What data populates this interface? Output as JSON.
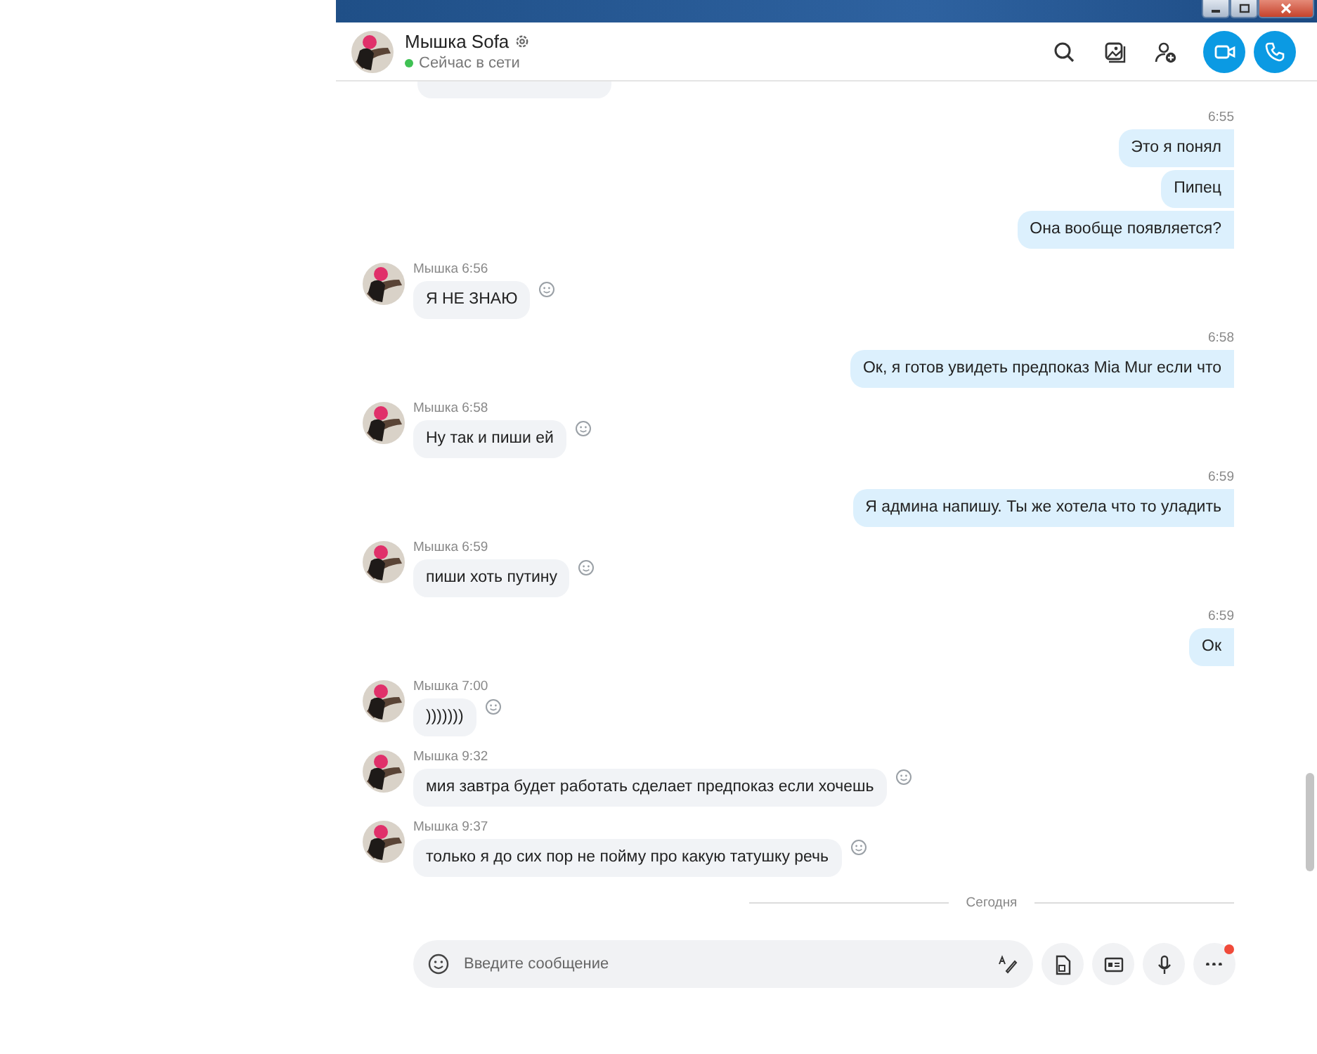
{
  "window_controls": [
    {
      "kind": "minimize"
    },
    {
      "kind": "maximize"
    },
    {
      "kind": "close"
    }
  ],
  "header": {
    "contact_name": "Мышка Sofa",
    "status": "Сейчас в сети",
    "online": true,
    "actions": [
      {
        "kind": "search"
      },
      {
        "kind": "gallery"
      },
      {
        "kind": "add_person"
      },
      {
        "kind": "video_call"
      },
      {
        "kind": "audio_call"
      }
    ]
  },
  "messages": [
    {
      "kind": "clipped"
    },
    {
      "kind": "outgoing",
      "time": "6:55",
      "texts": [
        "Это я понял",
        "Пипец",
        "Она вообще появляется?"
      ]
    },
    {
      "kind": "incoming",
      "sender": "Мышка",
      "time": "6:56",
      "text": "Я НЕ ЗНАЮ"
    },
    {
      "kind": "outgoing",
      "time": "6:58",
      "texts": [
        "Ок, я готов увидеть предпоказ Mia Mur если что"
      ]
    },
    {
      "kind": "incoming",
      "sender": "Мышка",
      "time": "6:58",
      "text": "Ну так и пиши ей"
    },
    {
      "kind": "outgoing",
      "time": "6:59",
      "texts": [
        "Я админа напишу. Ты же хотела что то уладить"
      ]
    },
    {
      "kind": "incoming",
      "sender": "Мышка",
      "time": "6:59",
      "text": "пиши хоть путину"
    },
    {
      "kind": "outgoing",
      "time": "6:59",
      "texts": [
        "Ок"
      ]
    },
    {
      "kind": "incoming",
      "sender": "Мышка",
      "time": "7:00",
      "text": ")))))))"
    },
    {
      "kind": "incoming",
      "sender": "Мышка",
      "time": "9:32",
      "text": "мия завтра будет работать сделает предпоказ если хочешь"
    },
    {
      "kind": "incoming",
      "sender": "Мышка",
      "time": "9:37",
      "text": "только я до сих пор не пойму про какую татушку речь"
    },
    {
      "kind": "date_divider",
      "label": "Сегодня"
    }
  ],
  "composer": {
    "placeholder": "Введите сообщение",
    "buttons": [
      {
        "kind": "file",
        "badge": false
      },
      {
        "kind": "contact_card",
        "badge": false
      },
      {
        "kind": "microphone",
        "badge": false
      },
      {
        "kind": "more",
        "badge": true
      }
    ]
  }
}
